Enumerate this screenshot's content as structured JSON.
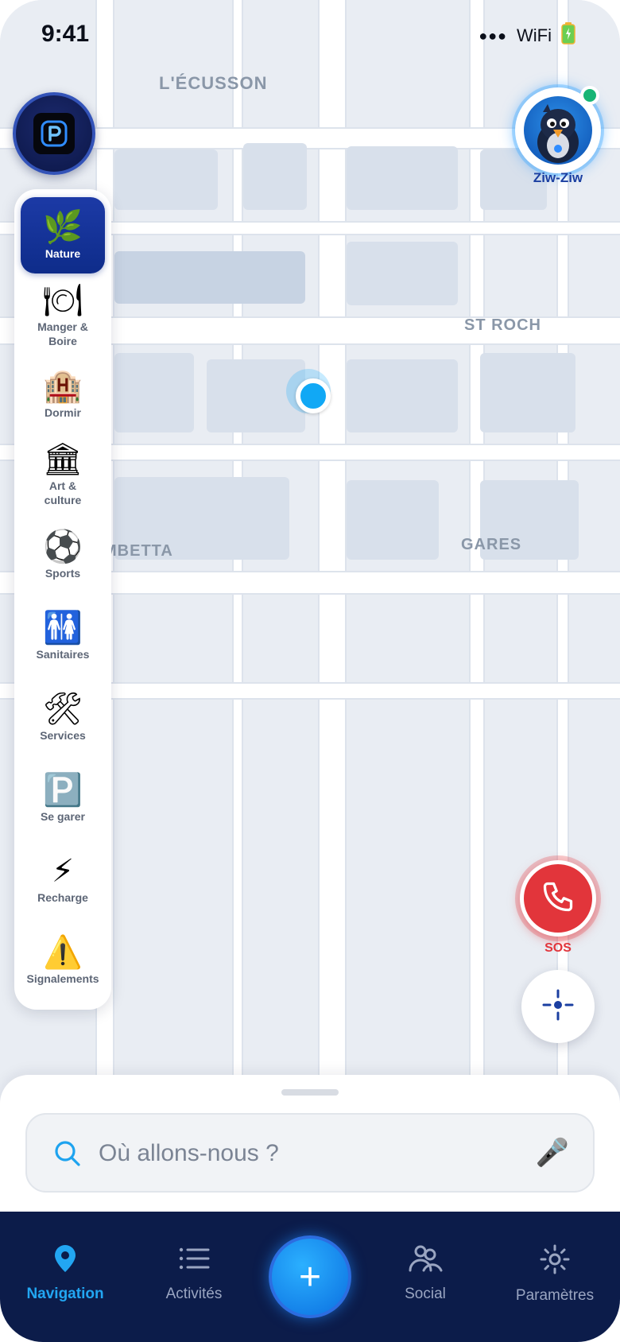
{
  "status_bar": {
    "time": "9:41",
    "signal": "●●●",
    "wifi": "WiFi",
    "battery_icon": "battery-icon"
  },
  "map": {
    "districts": [
      "L'ÉCUSSON",
      "ST ROCH",
      "MBETTA",
      "GARES"
    ]
  },
  "user": {
    "name": "Ziw-Ziw",
    "online": true
  },
  "categories": [
    {
      "icon": "🌿",
      "label": "Nature",
      "active": true
    },
    {
      "icon": "🍽",
      "label": "Manger & Boire"
    },
    {
      "icon": "🏨",
      "label": "Dormir"
    },
    {
      "icon": "🏛",
      "label": "Art & culture"
    },
    {
      "icon": "⚽",
      "label": "Sports"
    },
    {
      "icon": "🚻",
      "label": "Sanitaires"
    },
    {
      "icon": "🛠",
      "label": "Services"
    },
    {
      "icon": "🅿️",
      "label": "Se garer"
    },
    {
      "icon": "⚡",
      "label": "Recharge"
    },
    {
      "icon": "⚠️",
      "label": "Signalements"
    }
  ],
  "sos": {
    "label": "SOS"
  },
  "search": {
    "placeholder": "Où allons-nous ?"
  },
  "tabs": [
    {
      "label": "Navigation",
      "icon": "map-pin-icon",
      "active": true
    },
    {
      "label": "Activités",
      "icon": "list-icon"
    },
    {
      "label": "+",
      "icon": "plus-icon"
    },
    {
      "label": "Social",
      "icon": "users-icon"
    },
    {
      "label": "Paramètres",
      "icon": "gear-icon"
    }
  ],
  "colors": {
    "accent": "#22a6f2",
    "navy": "#0c1c4a",
    "sos": "#e2353b"
  }
}
